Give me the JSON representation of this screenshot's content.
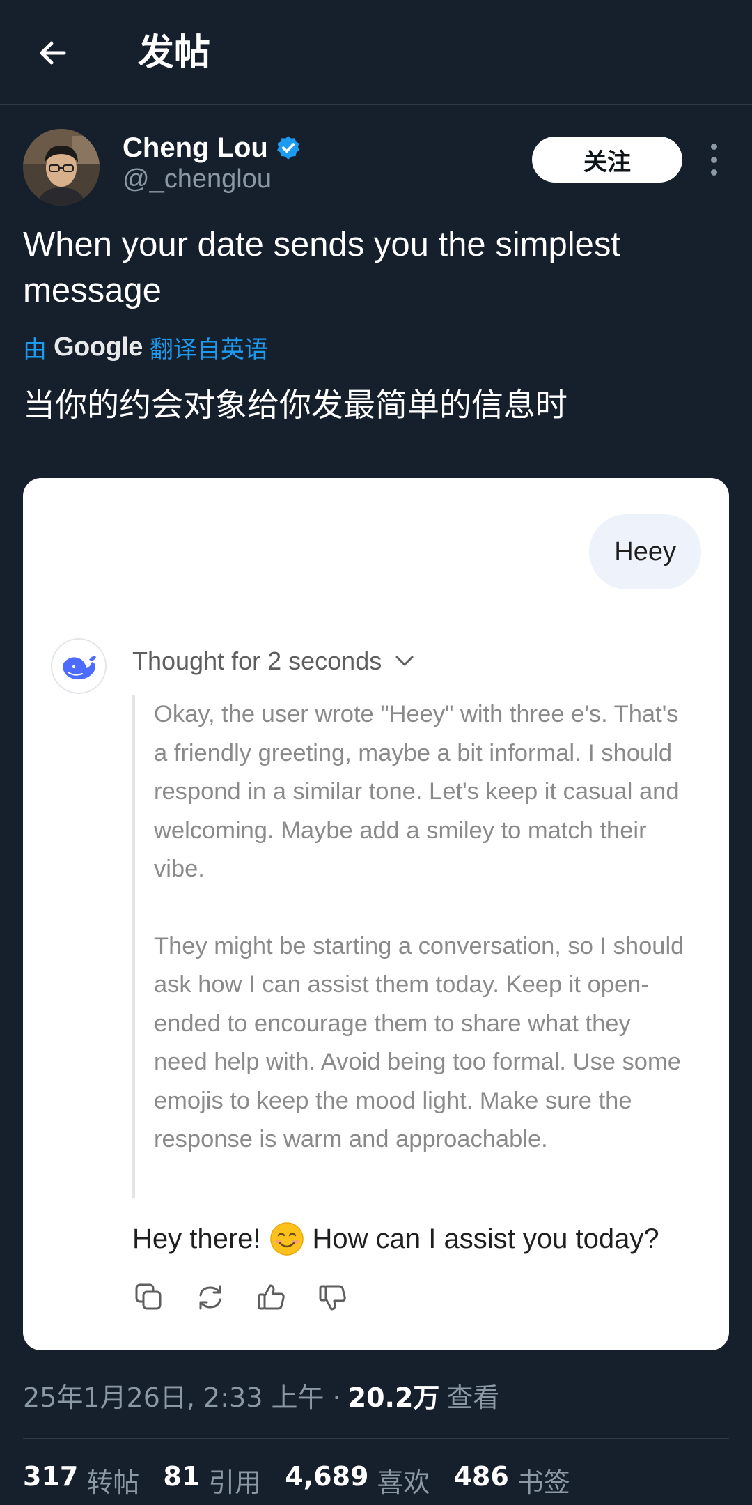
{
  "header": {
    "title": "发帖"
  },
  "author": {
    "name": "Cheng Lou",
    "handle": "@_chenglou",
    "follow_label": "关注"
  },
  "tweet": {
    "text": "When your date sends you the simplest message",
    "translate_by": "由",
    "translate_google": "Google",
    "translate_from": "翻译自英语",
    "translated_text": "当你的约会对象给你发最简单的信息时"
  },
  "card": {
    "user_message": "Heey",
    "thought_label": "Thought for 2 seconds",
    "thought_paragraphs": [
      "Okay, the user wrote \"Heey\" with three e's. That's a friendly greeting, maybe a bit informal. I should respond in a similar tone. Let's keep it casual and welcoming. Maybe add a smiley to match their vibe.",
      "They might be starting a conversation, so I should ask how I can assist them today. Keep it open-ended to encourage them to share what they need help with. Avoid being too formal. Use some emojis to keep the mood light. Make sure the response is warm and approachable."
    ],
    "reply_before": "Hey there!",
    "reply_after": "How can I assist you today?",
    "actions": [
      "copy-icon",
      "regenerate-icon",
      "thumbs-up-icon",
      "thumbs-down-icon"
    ]
  },
  "meta": {
    "datetime": "25年1月26日, 2:33 上午 ·",
    "views": "20.2万",
    "views_label": "查看"
  },
  "stats": {
    "retweets": "317",
    "retweets_label": "转帖",
    "quotes": "81",
    "quotes_label": "引用",
    "likes": "4,689",
    "likes_label": "喜欢",
    "bookmarks": "486",
    "bookmarks_label": "书签"
  },
  "colors": {
    "background": "#16202c",
    "accent": "#1d9bf0",
    "card": "#ffffff",
    "bubble": "#eef2fa",
    "deepseek_blue": "#4d6bfe"
  }
}
